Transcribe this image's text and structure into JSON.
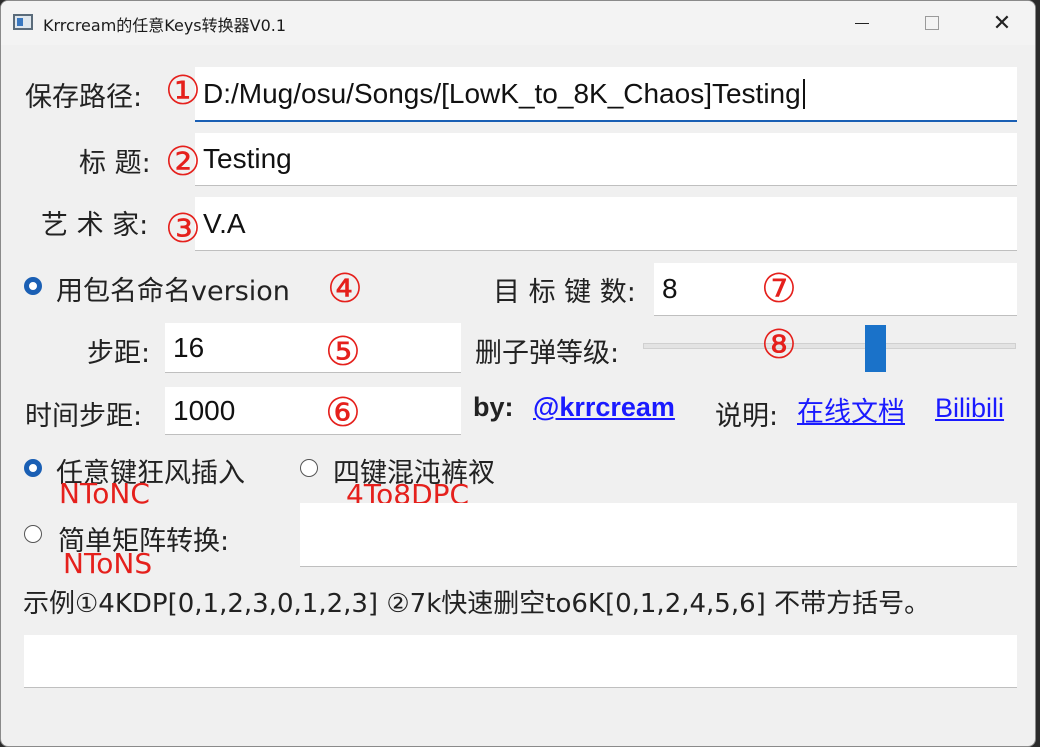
{
  "window": {
    "title": "Krrcream的任意Keys转换器V0.1",
    "minimize_icon": "minimize-icon",
    "maximize_icon": "maximize-icon",
    "close_icon": "close-icon",
    "close_glyph": "✕"
  },
  "form": {
    "save_path": {
      "label": "保存路径:",
      "value": "D:/Mug/osu/Songs/[LowK_to_8K_Chaos]Testing",
      "marker": "①"
    },
    "title": {
      "label": "标 题:",
      "value": "Testing",
      "marker": "②"
    },
    "artist": {
      "label": "艺 术 家:",
      "value": "V.A",
      "marker": "③"
    },
    "use_pack_name": {
      "label": "用包名命名version",
      "marker": "④",
      "selected": true
    },
    "target_keys": {
      "label": "目 标 键 数:",
      "value": "8",
      "marker": "⑦"
    },
    "step": {
      "label": "步距:",
      "value": "16",
      "marker": "⑤"
    },
    "delete_level": {
      "label": "删子弹等级:",
      "marker": "⑧",
      "level": 0.63
    },
    "time_step": {
      "label": "时间步距:",
      "value": "1000",
      "marker": "⑥"
    }
  },
  "credits": {
    "by_label": "by:",
    "author_link": "@krrcream",
    "desc_label": "说明:",
    "doc_link": "在线文档",
    "bili_link": "Bilibili"
  },
  "modes": {
    "any_key": {
      "label": "任意键狂风插入",
      "tag": "NToNC",
      "selected": true
    },
    "four_key": {
      "label": "四键混沌裤衩",
      "tag": "4To8DPC",
      "selected": false
    },
    "matrix": {
      "label": "简单矩阵转换:",
      "tag": "NToNS",
      "selected": false,
      "value": ""
    }
  },
  "example": {
    "text": "示例①4KDP[0,1,2,3,0,1,2,3] ②7k快速删空to6K[0,1,2,4,5,6] 不带方括号。",
    "value": ""
  }
}
